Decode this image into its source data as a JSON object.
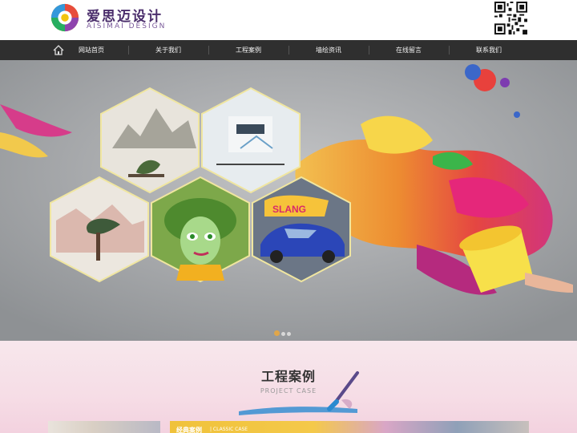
{
  "header": {
    "logo_cn": "爱思迈设计",
    "logo_en": "AISIMAI DESIGN"
  },
  "nav": {
    "items": [
      {
        "label": "网站首页"
      },
      {
        "label": "关于我们"
      },
      {
        "label": "工程案例"
      },
      {
        "label": "墙绘资讯"
      },
      {
        "label": "在线留言"
      },
      {
        "label": "联系我们"
      }
    ]
  },
  "banner": {
    "slide_count": 3,
    "active_slide": 1
  },
  "project": {
    "title": "工程案例",
    "subtitle": "PROJECT CASE",
    "case_tag": "经典案例",
    "case_tag_en": "| CLASSIC CASE"
  },
  "colors": {
    "nav_bg": "#2f2f2f",
    "accent": "#e0a64a",
    "logo_purple": "#4a2d6b"
  }
}
